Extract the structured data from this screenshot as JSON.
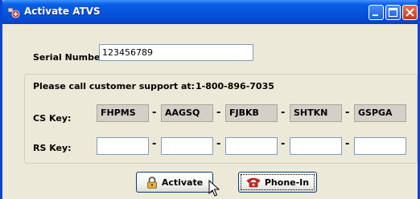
{
  "window": {
    "title": "Activate ATVS",
    "controls": [
      "minimize-icon",
      "maximize-icon",
      "close-icon"
    ]
  },
  "serial": {
    "label": "Serial Number:",
    "value": "123456789"
  },
  "support": {
    "label": "Please call customer support at:",
    "phone": "1-800-896-7035"
  },
  "cs_key": {
    "label": "CS Key:",
    "parts": [
      "FHPMS",
      "AAGSQ",
      "FJBKB",
      "SHTKN",
      "GSPGA"
    ]
  },
  "rs_key": {
    "label": "RS Key:",
    "parts": [
      "",
      "",
      "",
      "",
      ""
    ]
  },
  "separator": "-",
  "buttons": {
    "activate": {
      "label": "Activate",
      "icon": "lock-icon"
    },
    "phone_in": {
      "label": "Phone-In",
      "icon": "telephone-icon"
    }
  },
  "colors": {
    "titlebar": "#0553dc",
    "dialog_bg": "#ece9d8",
    "readonly_bg": "#d4d0c8"
  }
}
